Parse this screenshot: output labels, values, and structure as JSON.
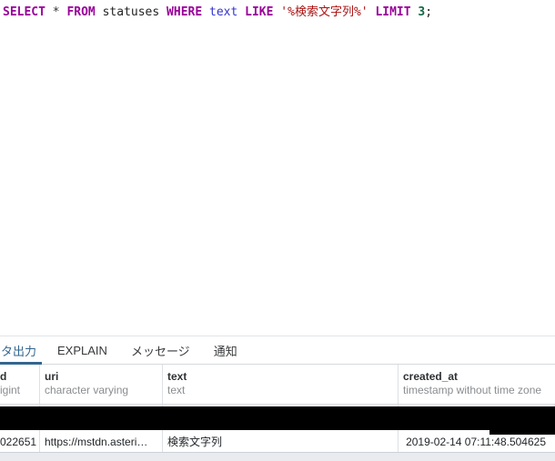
{
  "colors": {
    "keyword": "#990099",
    "operator": "#333333",
    "identifier": "#222222",
    "type": "#3333cc",
    "string": "#aa1111",
    "number": "#116644",
    "tab_active": "#326690"
  },
  "editor": {
    "tokens": [
      {
        "text": "SELECT "
      },
      {
        "text": "* "
      },
      {
        "text": "FROM "
      },
      {
        "text": "statuses "
      },
      {
        "text": "WHERE "
      },
      {
        "text": "text "
      },
      {
        "text": "LIKE "
      },
      {
        "text": "'%検索文字列%' "
      },
      {
        "text": "LIMIT "
      },
      {
        "text": "3"
      },
      {
        "text": ";"
      }
    ]
  },
  "tabs": [
    {
      "label": "タ出力",
      "active": true
    },
    {
      "label": "EXPLAIN",
      "active": false
    },
    {
      "label": "メッセージ",
      "active": false
    },
    {
      "label": "通知",
      "active": false
    }
  ],
  "grid": {
    "columns": [
      {
        "name": "d",
        "type": "igint"
      },
      {
        "name": "uri",
        "type": "character varying"
      },
      {
        "name": "text",
        "type": "text"
      },
      {
        "name": "created_at",
        "type": "timestamp without time zone"
      }
    ],
    "rows": [
      {
        "redacted": true
      },
      {
        "id": "022651",
        "uri": "https://mstdn.asteri…",
        "text": "検索文字列",
        "created_at": "2019-02-14 07:11:48.504625"
      }
    ]
  }
}
